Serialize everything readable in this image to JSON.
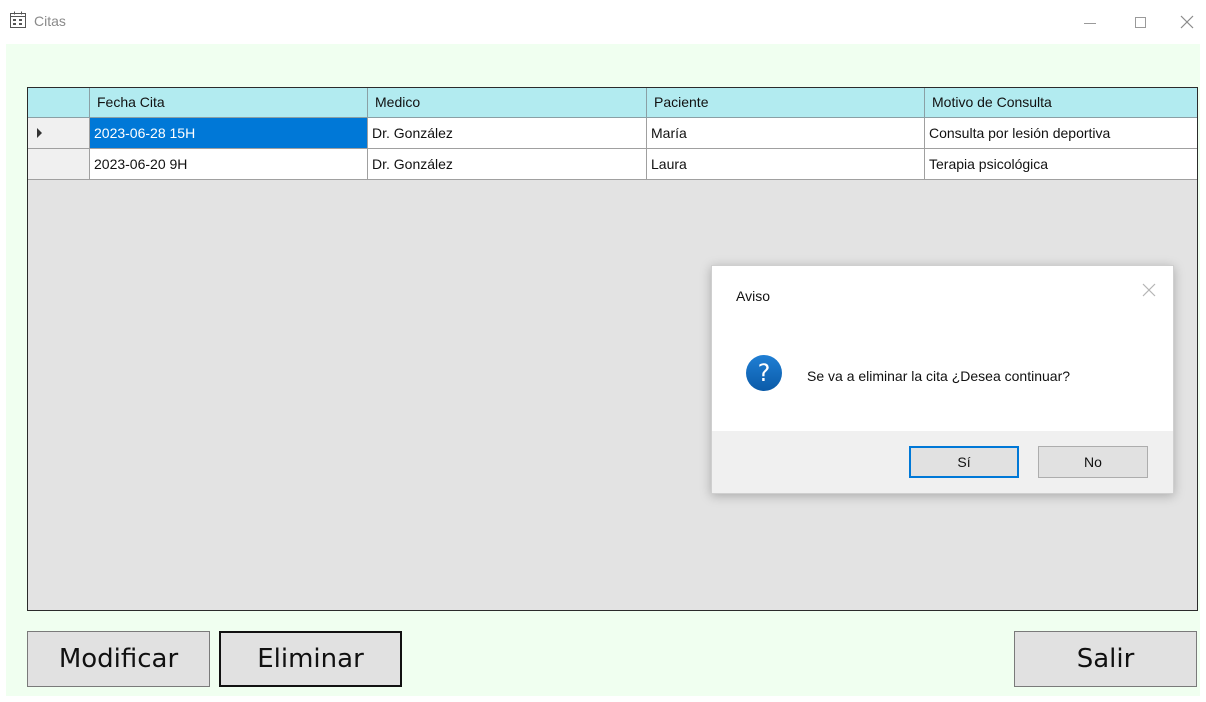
{
  "window": {
    "title": "Citas",
    "controls": {
      "minimize_icon": "minimize-icon",
      "maximize_icon": "maximize-icon",
      "close_icon": "close-icon"
    }
  },
  "grid": {
    "columns": [
      "Fecha Cita",
      "Medico",
      "Paciente",
      "Motivo de Consulta"
    ],
    "rows": [
      {
        "fecha": "2023-06-28 15H",
        "medico": "Dr. González",
        "paciente": "María",
        "motivo": "Consulta por lesión deportiva",
        "current": true
      },
      {
        "fecha": "2023-06-20 9H",
        "medico": "Dr. González",
        "paciente": "Laura",
        "motivo": "Terapia psicológica",
        "current": false
      }
    ],
    "colors": {
      "header_bg": "#b2ebf0",
      "selected_bg": "#0078d7",
      "empty_bg": "#e3e3e3"
    }
  },
  "buttons": {
    "modify_label": "Modificar",
    "delete_label": "Eliminar",
    "exit_label": "Salir"
  },
  "dialog": {
    "title": "Aviso",
    "icon": "question-icon",
    "icon_glyph": "?",
    "message": "Se va a eliminar la cita ¿Desea continuar?",
    "yes_label": "Sí",
    "no_label": "No"
  },
  "colors": {
    "client_bg": "#f0fff0",
    "accent": "#0078d7"
  }
}
